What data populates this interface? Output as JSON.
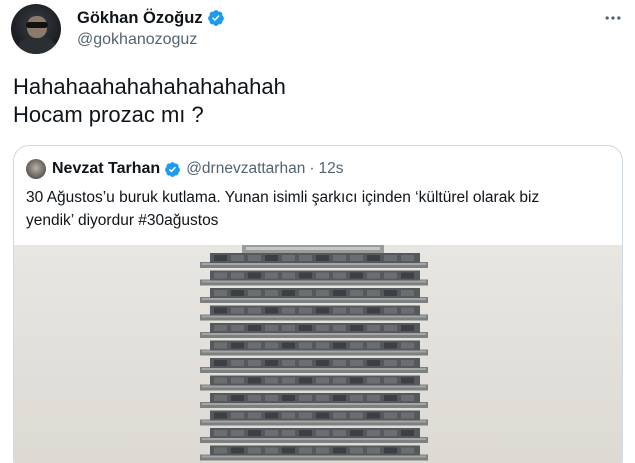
{
  "tweet": {
    "author": {
      "display_name": "Gökhan Özoğuz",
      "handle": "@gokhanozoguz",
      "verified": true,
      "avatar_icon": "profile-photo"
    },
    "more_icon": "more-horizontal-icon",
    "text_lines": [
      "Hahahaahahahahahahahah",
      "Hocam prozac mı ?"
    ]
  },
  "quoted_tweet": {
    "author": {
      "display_name": "Nevzat Tarhan",
      "handle": "@drnevzattarhan",
      "verified": true
    },
    "separator": "·",
    "time": "12s",
    "text_lines": [
      "30 Ağustos’u buruk kutlama. Yunan isimli şarkıcı içinden ‘kültürel olarak biz",
      "yendik’ diyordur #30ağustos"
    ],
    "media": "photo-of-skyscraper"
  },
  "colors": {
    "text_primary": "#0f1419",
    "text_secondary": "#536471",
    "verified_blue": "#1d9bf0",
    "border": "#cfd9de"
  }
}
